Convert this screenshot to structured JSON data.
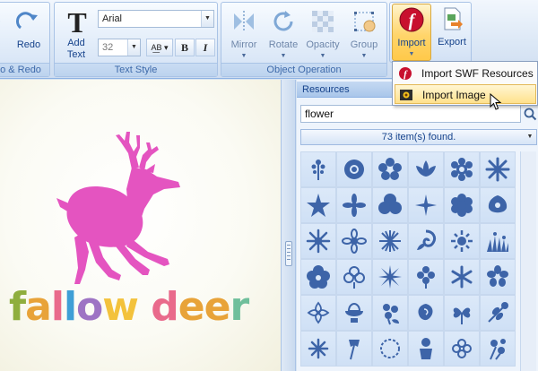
{
  "ribbon": {
    "undo_redo": {
      "redo_label": "Redo",
      "group_label": "o & Redo"
    },
    "text_style": {
      "add_text_label": "Add\nText",
      "font_value": "Arial",
      "size_value": "32",
      "bold_label": "B",
      "italic_label": "I",
      "group_label": "Text Style"
    },
    "object_operation": {
      "mirror_label": "Mirror",
      "rotate_label": "Rotate",
      "opacity_label": "Opacity",
      "group_label_btn": "Group",
      "group_label": "Object Operation"
    },
    "import_label": "Import",
    "export_label": "Export"
  },
  "import_menu": {
    "items": [
      {
        "label": "Import SWF Resources",
        "icon": "flash-icon"
      },
      {
        "label": "Import Image",
        "icon": "image-icon",
        "hovered": true
      }
    ]
  },
  "canvas": {
    "logo_text": [
      "f",
      "a",
      "l",
      "l",
      "o",
      "w",
      " ",
      "d",
      "e",
      "e",
      "r"
    ],
    "deer_color": "#e454c0"
  },
  "resources": {
    "title": "Resources",
    "search_value": "flower",
    "found_text": "73 item(s) found.",
    "icon_color": "#3d64a8"
  },
  "colors": {
    "ribbon_text": "#15428b",
    "highlight": "#ffd56b"
  }
}
